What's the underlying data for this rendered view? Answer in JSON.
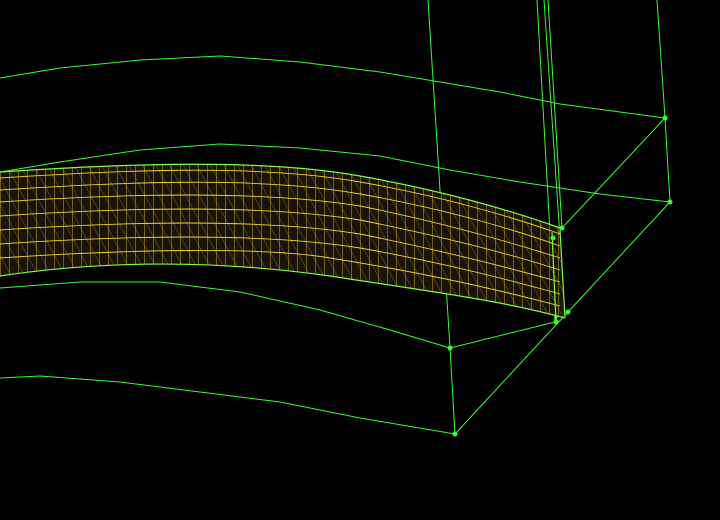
{
  "viewport": {
    "background_color": "#000000",
    "wireframe_color": "#33ff33",
    "mesh_color": "#f2d32b",
    "vertex_marker_color": "#33ff33"
  }
}
